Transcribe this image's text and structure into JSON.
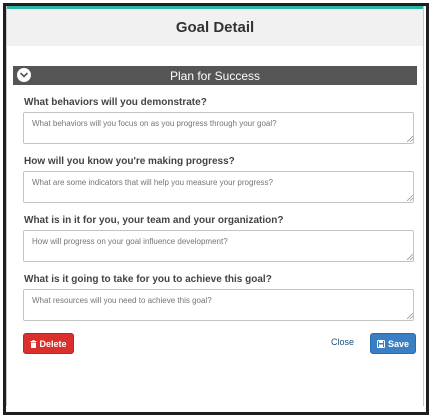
{
  "modal": {
    "title": "Goal Detail"
  },
  "section": {
    "title": "Plan for Success",
    "toggle_icon": "chevron-down-icon"
  },
  "fields": [
    {
      "label": "What behaviors will you demonstrate?",
      "placeholder": "What behaviors will you focus on as you progress through your goal?"
    },
    {
      "label": "How will you know you're making progress?",
      "placeholder": "What are some indicators that will help you measure your progress?"
    },
    {
      "label": "What is in it for you, your team and your organization?",
      "placeholder": "How will progress on your goal influence development?"
    },
    {
      "label": "What is it going to take for you to achieve this goal?",
      "placeholder": "What resources will you need to achieve this goal?"
    }
  ],
  "actions": {
    "delete_label": "Delete",
    "delete_icon": "trash-icon",
    "close_label": "Close",
    "save_label": "Save",
    "save_icon": "floppy-disk-icon"
  },
  "colors": {
    "header_accent": "#2bb3a5",
    "section_bar": "#555555",
    "delete": "#d9302b",
    "save": "#3a7fc4",
    "close_link": "#1f4e7a"
  }
}
